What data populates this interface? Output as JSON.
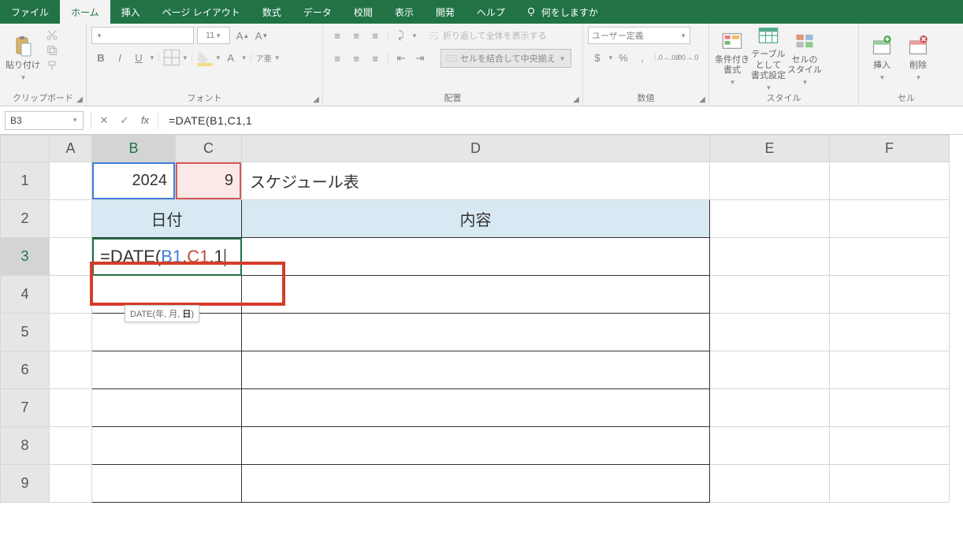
{
  "tabs": {
    "file": "ファイル",
    "home": "ホーム",
    "insert": "挿入",
    "page_layout": "ページ レイアウト",
    "formulas": "数式",
    "data": "データ",
    "review": "校閲",
    "view": "表示",
    "developer": "開発",
    "help": "ヘルプ"
  },
  "tell_me": "何をしますか",
  "ribbon": {
    "clipboard": {
      "paste": "貼り付け",
      "label": "クリップボード"
    },
    "font": {
      "name_placeholder": "",
      "size": "11",
      "bold": "B",
      "italic": "I",
      "underline": "U",
      "label": "フォント"
    },
    "alignment": {
      "wrap": "折り返して全体を表示する",
      "merge": "セルを結合して中央揃え",
      "label": "配置"
    },
    "number": {
      "format": "ユーザー定義",
      "label": "数値"
    },
    "styles": {
      "conditional": "条件付き\n書式",
      "table_fmt": "テーブルとして\n書式設定",
      "cell_styles": "セルの\nスタイル",
      "label": "スタイル"
    },
    "cells": {
      "insert": "挿入",
      "delete": "削除",
      "label": "セル"
    }
  },
  "formula_bar": {
    "name_box": "B3",
    "content": "=DATE(B1,C1,1"
  },
  "columns": [
    "A",
    "B",
    "C",
    "D",
    "E",
    "F"
  ],
  "rows": [
    "1",
    "2",
    "3",
    "4",
    "5",
    "6",
    "7",
    "8",
    "9"
  ],
  "cells": {
    "B1": "2024",
    "C1": "9",
    "D1": "スケジュール表",
    "B2C2": "日付",
    "D2": "内容",
    "B3_formula_prefix": "=DATE(",
    "B3_ref1": "B1",
    "B3_comma1": ",",
    "B3_ref2": "C1",
    "B3_comma2": ",",
    "B3_arg3": "1"
  },
  "tooltip": {
    "fn": "DATE(",
    "args": "年, 月, ",
    "arg_bold": "日",
    "end": ")"
  }
}
